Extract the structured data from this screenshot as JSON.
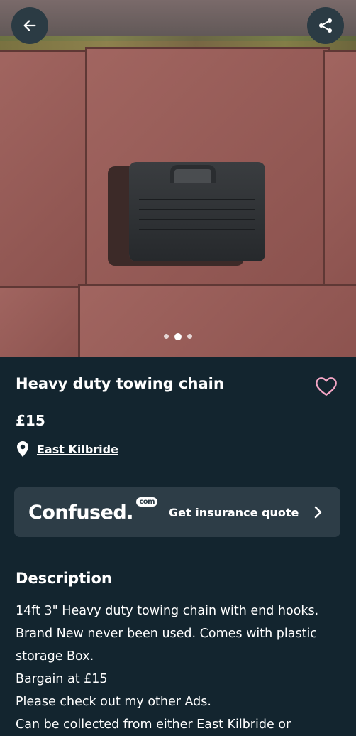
{
  "listing": {
    "title": "Heavy duty towing chain",
    "price": "£15",
    "location": "East Kilbride"
  },
  "gallery": {
    "image_count": 3,
    "active_index": 1
  },
  "promo": {
    "brand": "Confused.",
    "brand_badge": "com",
    "text": "Get insurance quote"
  },
  "description": {
    "heading": "Description",
    "lines": [
      "14ft 3\" Heavy duty towing chain with end hooks.",
      "Brand New never been used. Comes with plastic",
      "storage Box.",
      "Bargain at £15",
      "Please check out my other Ads.",
      "Can be collected from either East Kilbride or"
    ]
  },
  "colors": {
    "background": "#13252f",
    "card": "#2d3d47",
    "heart": "#f3a5c4"
  },
  "icons": [
    "back-arrow-icon",
    "share-icon",
    "heart-icon",
    "location-pin-icon",
    "chevron-right-icon"
  ]
}
